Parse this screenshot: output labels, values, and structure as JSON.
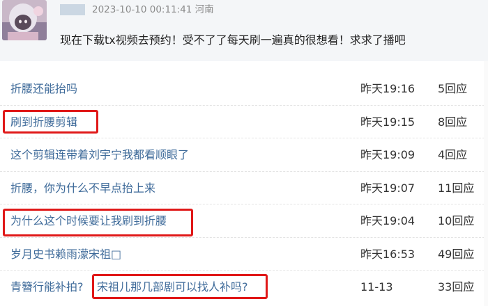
{
  "post": {
    "username": "",
    "timestamp": "2023-10-10 00:11:41 河南",
    "text": "现在下载tx视频去预约！受不了了每天刷一遍真的很想看！求求了播吧"
  },
  "threads": [
    {
      "title": "折腰还能抬吗",
      "time": "昨天19:16",
      "replies": "5回应"
    },
    {
      "title": "刷到折腰剪辑",
      "time": "昨天19:15",
      "replies": "8回应"
    },
    {
      "title": "这个剪辑连带着刘宇宁我都看顺眼了",
      "time": "昨天19:09",
      "replies": "4回应"
    },
    {
      "title": "折腰，你为什么不早点抬上来",
      "time": "昨天19:07",
      "replies": "11回应"
    },
    {
      "title": "为什么这个时候要让我刷到折腰",
      "time": "昨天19:04",
      "replies": "10回应"
    },
    {
      "title": "岁月史书赖雨濛宋祖□",
      "time": "昨天16:53",
      "replies": "49回应"
    },
    {
      "title_prefix": "青簪行能补拍?",
      "title": "宋祖儿那几部剧可以找人补吗?",
      "time": "11-13",
      "replies": "33回应"
    }
  ],
  "colors": {
    "link": "#3f6b9a",
    "highlight": "#e01818",
    "header_bg": "#f4f6f8"
  }
}
